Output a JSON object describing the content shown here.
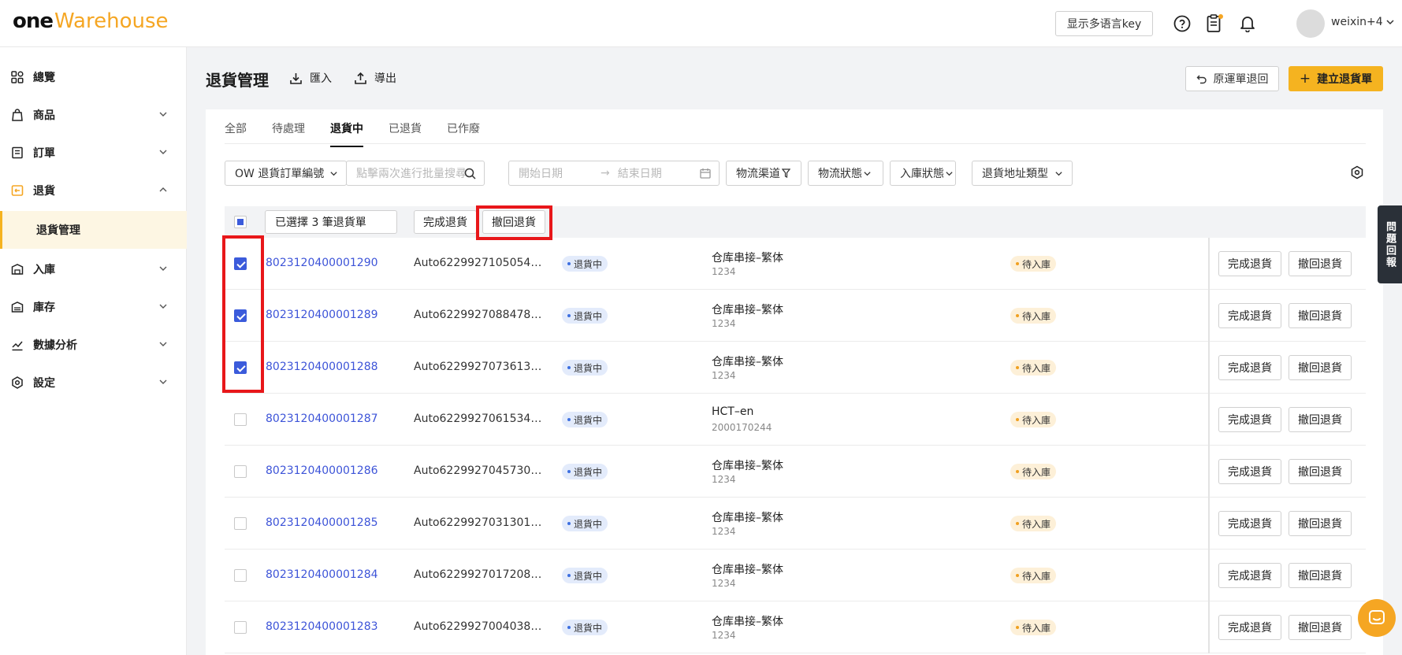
{
  "app": {
    "logo_one": "one",
    "logo_warehouse": "Warehouse"
  },
  "header": {
    "lang_key_label": "显示多语言key",
    "user_name": "weixin+4",
    "icons": [
      "help-icon",
      "clipboard-icon",
      "bell-icon"
    ],
    "notification_dot_color": "#f5a623"
  },
  "sidebar": {
    "items": [
      {
        "label": "總覽",
        "icon": "dashboard-icon",
        "expandable": false
      },
      {
        "label": "商品",
        "icon": "bag-icon",
        "expandable": true
      },
      {
        "label": "訂單",
        "icon": "order-icon",
        "expandable": true
      },
      {
        "label": "退貨",
        "icon": "return-icon",
        "expandable": true,
        "expanded": true
      },
      {
        "label": "入庫",
        "icon": "inbound-icon",
        "expandable": true
      },
      {
        "label": "庫存",
        "icon": "stock-icon",
        "expandable": true
      },
      {
        "label": "數據分析",
        "icon": "analytics-icon",
        "expandable": true
      },
      {
        "label": "設定",
        "icon": "settings-icon",
        "expandable": true
      }
    ],
    "sub_active": "退貨管理"
  },
  "page": {
    "title": "退貨管理",
    "import_label": "匯入",
    "export_label": "導出",
    "return_original_label": "原運單退回",
    "create_return_label": "建立退貨單"
  },
  "tabs": [
    {
      "label": "全部",
      "active": false
    },
    {
      "label": "待處理",
      "active": false
    },
    {
      "label": "退貨中",
      "active": true
    },
    {
      "label": "已退貨",
      "active": false
    },
    {
      "label": "已作廢",
      "active": false
    }
  ],
  "filters": {
    "search_field_select": "OW 退貨訂單編號",
    "search_placeholder": "點擊兩次進行批量搜尋",
    "start_date_placeholder": "開始日期",
    "end_date_placeholder": "結束日期",
    "date_separator": "→",
    "logistics_channel": "物流渠道",
    "logistics_status": "物流狀態",
    "inbound_status": "入庫狀態",
    "return_address_type": "退貨地址類型"
  },
  "bulk": {
    "selected_label": "已選擇 3 筆退貨單",
    "complete_label": "完成退貨",
    "revoke_label": "撤回退貨",
    "highlight_color": "#e8171a"
  },
  "rows": [
    {
      "checked": true,
      "order": "8023120400001290",
      "ref": "Auto62299271050543...",
      "status": "退貨中",
      "channel": "仓库串接–繁体",
      "code": "1234",
      "inbound": "待入庫"
    },
    {
      "checked": true,
      "order": "8023120400001289",
      "ref": "Auto62299270884784...",
      "status": "退貨中",
      "channel": "仓库串接–繁体",
      "code": "1234",
      "inbound": "待入庫"
    },
    {
      "checked": true,
      "order": "8023120400001288",
      "ref": "Auto62299270736138...",
      "status": "退貨中",
      "channel": "仓库串接–繁体",
      "code": "1234",
      "inbound": "待入庫"
    },
    {
      "checked": false,
      "order": "8023120400001287",
      "ref": "Auto62299270615342...",
      "status": "退貨中",
      "channel": "HCT–en",
      "code": "2000170244",
      "inbound": "待入庫"
    },
    {
      "checked": false,
      "order": "8023120400001286",
      "ref": "Auto62299270457301...",
      "status": "退貨中",
      "channel": "仓库串接–繁体",
      "code": "1234",
      "inbound": "待入庫"
    },
    {
      "checked": false,
      "order": "8023120400001285",
      "ref": "Auto622992703130174...",
      "status": "退貨中",
      "channel": "仓库串接–繁体",
      "code": "1234",
      "inbound": "待入庫"
    },
    {
      "checked": false,
      "order": "8023120400001284",
      "ref": "Auto62299270172088...",
      "status": "退貨中",
      "channel": "仓库串接–繁体",
      "code": "1234",
      "inbound": "待入庫"
    },
    {
      "checked": false,
      "order": "8023120400001283",
      "ref": "Auto62299270040387...",
      "status": "退貨中",
      "channel": "仓库串接–繁体",
      "code": "1234",
      "inbound": "待入庫"
    }
  ],
  "row_actions": {
    "complete": "完成退貨",
    "revoke": "撤回退貨"
  },
  "feedback_tab": "問題回報",
  "colors": {
    "accent": "#f5b320",
    "link": "#3d54d8",
    "checkbox": "#3b5bdb"
  }
}
